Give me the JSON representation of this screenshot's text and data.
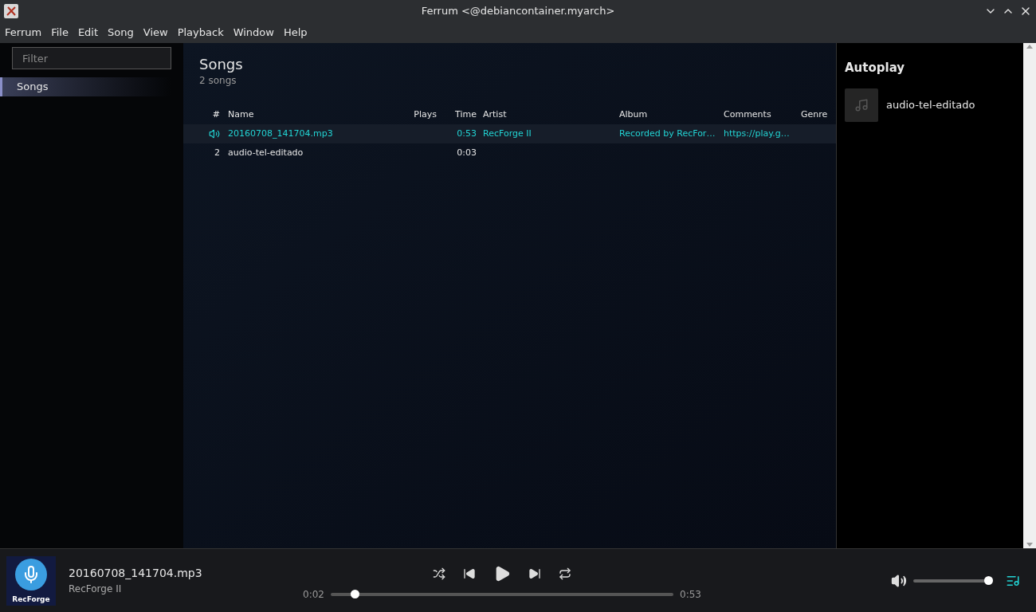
{
  "window": {
    "title": "Ferrum <@debiancontainer.myarch>"
  },
  "menu": [
    "Ferrum",
    "File",
    "Edit",
    "Song",
    "View",
    "Playback",
    "Window",
    "Help"
  ],
  "sidebar": {
    "filter": {
      "placeholder": "Filter"
    },
    "items": [
      {
        "label": "Songs",
        "selected": true
      }
    ]
  },
  "content": {
    "title": "Songs",
    "subtitle": "2 songs",
    "columns": [
      "#",
      "Name",
      "Plays",
      "Time",
      "Artist",
      "Album",
      "Comments",
      "Genre"
    ],
    "rows": [
      {
        "playing": true,
        "selected": true,
        "name": "20160708_141704.mp3",
        "time": "0:53",
        "artist": "RecForge II",
        "album": "Recorded by RecFor…",
        "comments": "https://play.g…"
      },
      {
        "playing": false,
        "selected": false,
        "number": "2",
        "name": "audio-tel-editado",
        "time": "0:03"
      }
    ]
  },
  "autoplay": {
    "title": "Autoplay",
    "items": [
      {
        "title": "audio-tel-editado"
      }
    ]
  },
  "player": {
    "title": "20160708_141704.mp3",
    "artist": "RecForge II",
    "cover_text": "RecForge",
    "elapsed": "0:02",
    "duration": "0:53",
    "progress": {
      "level": 0.06
    },
    "volume": {
      "level": 1.0
    },
    "queue_open": true
  }
}
